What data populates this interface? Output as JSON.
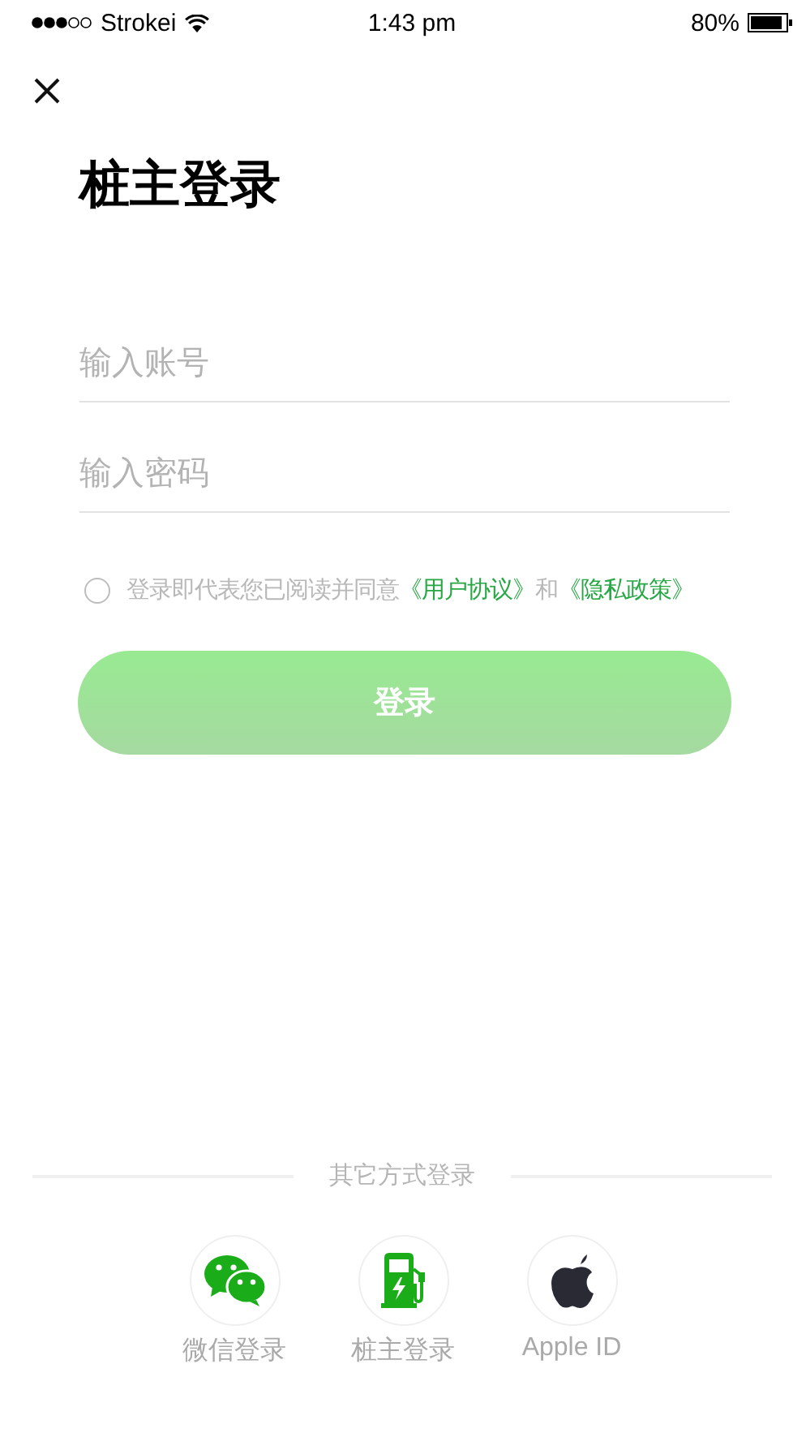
{
  "status_bar": {
    "carrier": "Strokei",
    "time": "1:43 pm",
    "battery": "80%"
  },
  "title": "桩主登录",
  "fields": [
    {
      "placeholder": "输入账号"
    },
    {
      "placeholder": "输入密码"
    }
  ],
  "agreement": {
    "checked": false,
    "text": "登录即代表您已阅读并同意",
    "link_1": "《用户协议》",
    "conjunction": "和",
    "link_2": "《隐私政策》"
  },
  "login_button": "登录",
  "other_methods": {
    "heading": "其它方式登录",
    "options": [
      {
        "kind": "wechat",
        "label": "微信登录"
      },
      {
        "kind": "charger",
        "label": "桩主登录"
      },
      {
        "kind": "apple",
        "label": "Apple ID"
      }
    ]
  }
}
